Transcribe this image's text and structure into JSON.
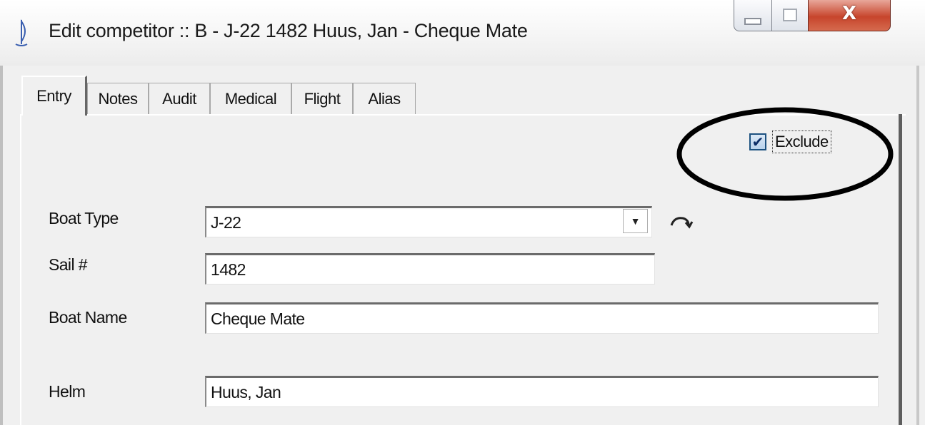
{
  "window": {
    "title": "Edit competitor :: B - J-22 1482 Huus, Jan - Cheque Mate",
    "minimize_icon": "minimize-icon",
    "maximize_icon": "maximize-icon",
    "close_glyph": "X"
  },
  "tabs": [
    {
      "label": "Entry",
      "active": true
    },
    {
      "label": "Notes",
      "active": false
    },
    {
      "label": "Audit",
      "active": false
    },
    {
      "label": "Medical",
      "active": false
    },
    {
      "label": "Flight",
      "active": false
    },
    {
      "label": "Alias",
      "active": false
    }
  ],
  "exclude": {
    "label": "Exclude",
    "checked": true,
    "check_glyph": "✔"
  },
  "form": {
    "boat_type": {
      "label": "Boat Type",
      "value": "J-22",
      "arrow": "▼"
    },
    "sail_number": {
      "label": "Sail #",
      "value": "1482"
    },
    "boat_name": {
      "label": "Boat Name",
      "value": "Cheque Mate"
    },
    "helm": {
      "label": "Helm",
      "value": "Huus, Jan"
    }
  },
  "colors": {
    "client_bg": "#f0f0f0",
    "close_button": "#c7452c",
    "checkbox_check": "#0b2d66",
    "annotation_ellipse": "#000000"
  }
}
